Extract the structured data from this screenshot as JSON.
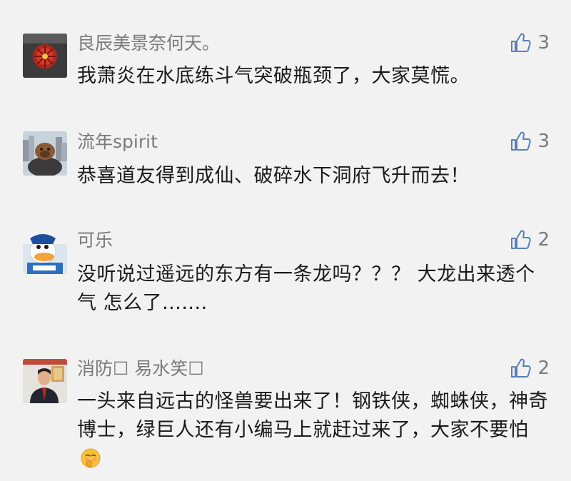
{
  "comments": [
    {
      "username": "良辰美景奈何天。",
      "likes": "3",
      "text": "我萧炎在水底练斗气突破瓶颈了，大家莫慌。",
      "avatar": "red-flower-avatar"
    },
    {
      "username": "流年spirit",
      "likes": "3",
      "text": "恭喜道友得到成仙、破碎水下洞府飞升而去！",
      "avatar": "dog-city-avatar"
    },
    {
      "username": "可乐",
      "likes": "2",
      "text": "没听说过遥远的东方有一条龙吗？？？ 大龙出来透个气 怎么了.......",
      "avatar": "donald-duck-avatar"
    },
    {
      "username": "消防☐  易水笑☐",
      "likes": "2",
      "text": "一头来自远古的怪兽要出来了！钢铁侠，蜘蛛侠，神奇博士，绿巨人还有小编马上就赶过来了，大家不要怕",
      "emoji": "🤭",
      "avatar": "man-portrait-avatar"
    }
  ],
  "icons": {
    "like": "thumbs-up-icon"
  },
  "colors": {
    "background": "#f2f2f2",
    "username": "#7a7a7a",
    "text": "#1a1a1a"
  }
}
